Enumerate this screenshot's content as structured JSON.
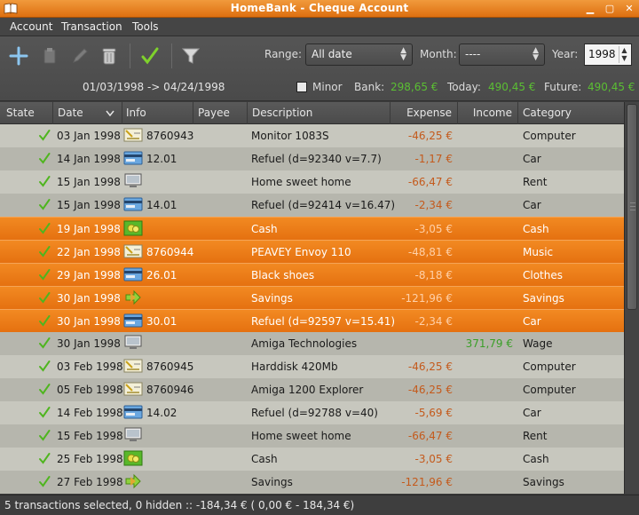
{
  "window": {
    "title": "HomeBank - Cheque Account"
  },
  "menu": {
    "account": "Account",
    "transaction": "Transaction",
    "tools": "Tools"
  },
  "filters": {
    "range_label": "Range:",
    "range_value": "All date",
    "month_label": "Month:",
    "month_value": "----",
    "year_label": "Year:",
    "year_value": "1998",
    "date_span": "01/03/1998 -> 04/24/1998",
    "minor_label": "Minor",
    "bank_label": "Bank:",
    "bank_value": "298,65 €",
    "today_label": "Today:",
    "today_value": "490,45 €",
    "future_label": "Future:",
    "future_value": "490,45 €"
  },
  "columns": {
    "state": "State",
    "date": "Date",
    "info": "Info",
    "payee": "Payee",
    "description": "Description",
    "expense": "Expense",
    "income": "Income",
    "category": "Category"
  },
  "colors": {
    "selection": "#e97a17",
    "expense": "#c45a1c",
    "income": "#3a9f27",
    "balance": "#5bbf33"
  },
  "rows": [
    {
      "date": "03 Jan 1998",
      "icon": "cheque-icon",
      "info": "8760943",
      "description": "Monitor 1083S",
      "expense": "-46,25 €",
      "income": "",
      "category": "Computer",
      "selected": false
    },
    {
      "date": "14 Jan 1998",
      "icon": "credit-card-icon",
      "info": "12.01",
      "description": "Refuel (d=92340 v=7.7)",
      "expense": "-1,17 €",
      "income": "",
      "category": "Car",
      "selected": false
    },
    {
      "date": "15 Jan 1998",
      "icon": "transfer-screen-icon",
      "info": "",
      "description": "Home sweet home",
      "expense": "-66,47 €",
      "income": "",
      "category": "Rent",
      "selected": false
    },
    {
      "date": "15 Jan 1998",
      "icon": "credit-card-icon",
      "info": "14.01",
      "description": "Refuel (d=92414 v=16.47)",
      "expense": "-2,34 €",
      "income": "",
      "category": "Car",
      "selected": false
    },
    {
      "date": "19 Jan 1998",
      "icon": "cash-icon",
      "info": "",
      "description": "Cash",
      "expense": "-3,05 €",
      "income": "",
      "category": "Cash",
      "selected": true
    },
    {
      "date": "22 Jan 1998",
      "icon": "cheque-icon",
      "info": "8760944",
      "description": "PEAVEY Envoy 110",
      "expense": "-48,81 €",
      "income": "",
      "category": "Music",
      "selected": true
    },
    {
      "date": "29 Jan 1998",
      "icon": "credit-card-icon",
      "info": "26.01",
      "description": "Black shoes",
      "expense": "-8,18 €",
      "income": "",
      "category": "Clothes",
      "selected": true
    },
    {
      "date": "30 Jan 1998",
      "icon": "internal-transfer-icon",
      "info": "",
      "description": "Savings",
      "expense": "-121,96 €",
      "income": "",
      "category": "Savings",
      "selected": true
    },
    {
      "date": "30 Jan 1998",
      "icon": "credit-card-icon",
      "info": "30.01",
      "description": "Refuel (d=92597 v=15.41)",
      "expense": "-2,34 €",
      "income": "",
      "category": "Car",
      "selected": true
    },
    {
      "date": "30 Jan 1998",
      "icon": "transfer-screen-icon",
      "info": "",
      "description": "Amiga Technologies",
      "expense": "",
      "income": "371,79 €",
      "category": "Wage",
      "selected": false
    },
    {
      "date": "03 Feb 1998",
      "icon": "cheque-icon",
      "info": "8760945",
      "description": "Harddisk 420Mb",
      "expense": "-46,25 €",
      "income": "",
      "category": "Computer",
      "selected": false
    },
    {
      "date": "05 Feb 1998",
      "icon": "cheque-icon",
      "info": "8760946",
      "description": "Amiga 1200 Explorer",
      "expense": "-46,25 €",
      "income": "",
      "category": "Computer",
      "selected": false
    },
    {
      "date": "14 Feb 1998",
      "icon": "credit-card-icon",
      "info": "14.02",
      "description": "Refuel (d=92788 v=40)",
      "expense": "-5,69 €",
      "income": "",
      "category": "Car",
      "selected": false
    },
    {
      "date": "15 Feb 1998",
      "icon": "transfer-screen-icon",
      "info": "",
      "description": "Home sweet home",
      "expense": "-66,47 €",
      "income": "",
      "category": "Rent",
      "selected": false
    },
    {
      "date": "25 Feb 1998",
      "icon": "cash-icon",
      "info": "",
      "description": "Cash",
      "expense": "-3,05 €",
      "income": "",
      "category": "Cash",
      "selected": false
    },
    {
      "date": "27 Feb 1998",
      "icon": "internal-transfer-icon",
      "info": "",
      "description": "Savings",
      "expense": "-121,96 €",
      "income": "",
      "category": "Savings",
      "selected": false
    }
  ],
  "status": {
    "text": "5 transactions selected, 0 hidden :: -184,34 € ( 0,00 € - 184,34 €)"
  }
}
